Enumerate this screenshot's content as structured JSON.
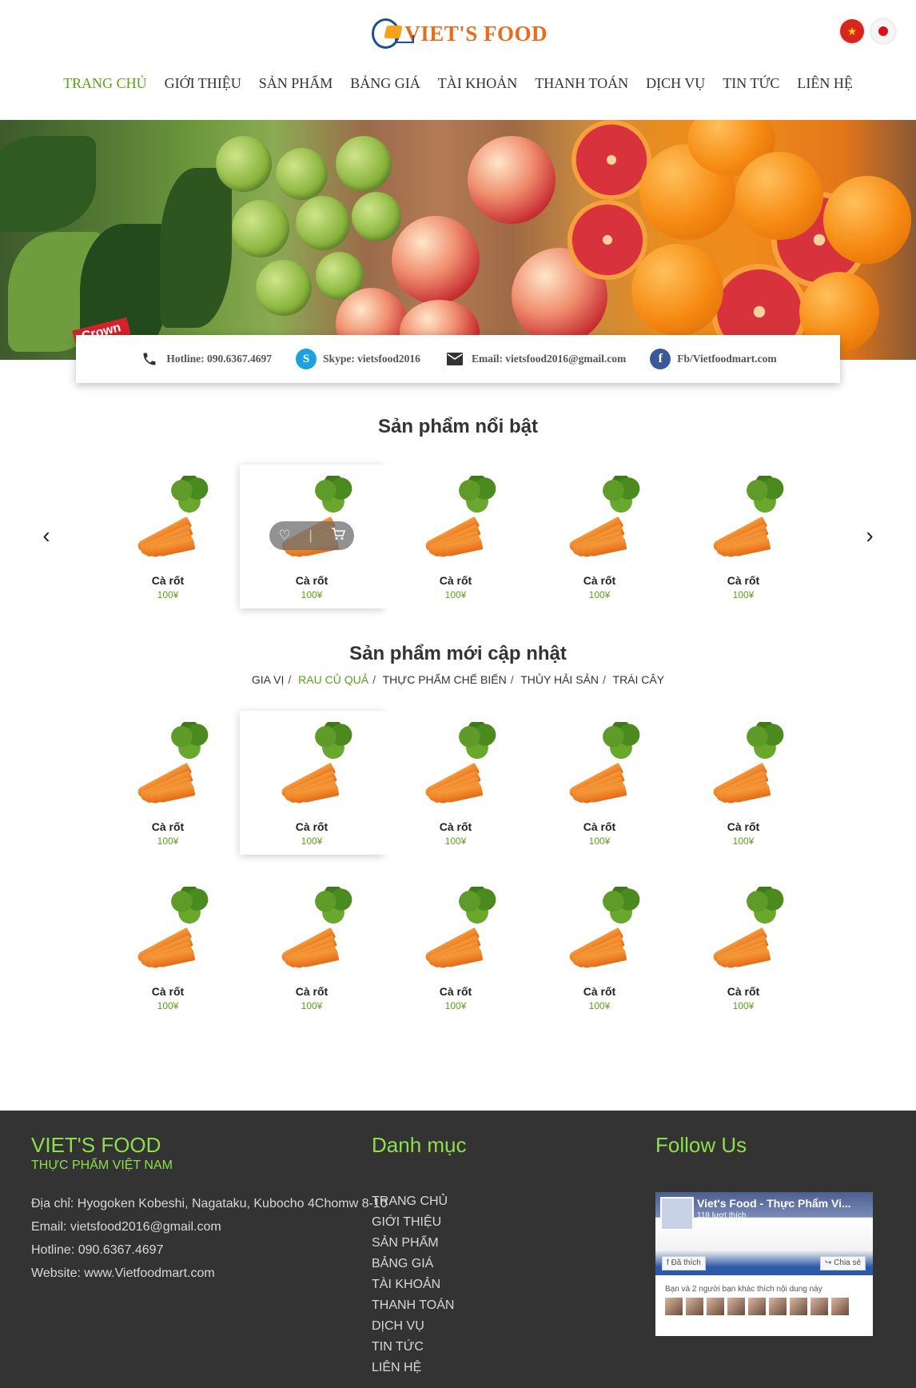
{
  "brand": {
    "logo_text": "VIET'S FOOD"
  },
  "nav": [
    "TRANG CHỦ",
    "GIỚI THIỆU",
    "SẢN PHẨM",
    "BẢNG GIÁ",
    "TÀI KHOẢN",
    "THANH TOÁN",
    "DỊCH VỤ",
    "TIN TỨC",
    "LIÊN HỆ"
  ],
  "nav_active_index": 0,
  "hero": {
    "ribbon_text": "Crown"
  },
  "contact": {
    "hotline": "Hotline: 090.6367.4697",
    "skype": "Skype: vietsfood2016",
    "email": "Email: vietsfood2016@gmail.com",
    "facebook": "Fb/Vietfoodmart.com"
  },
  "featured": {
    "title": "Sản phẩm nổi bật",
    "products": [
      {
        "name": "Cà rốt",
        "price": "100¥"
      },
      {
        "name": "Cà rốt",
        "price": "100¥"
      },
      {
        "name": "Cà rốt",
        "price": "100¥"
      },
      {
        "name": "Cà rốt",
        "price": "100¥"
      },
      {
        "name": "Cà rốt",
        "price": "100¥"
      }
    ]
  },
  "latest": {
    "title": "Sản phẩm mới cập nhật",
    "filters": [
      "GIA VỊ",
      "RAU CỦ QUẢ",
      "THỰC PHẨM CHẾ BIẾN",
      "THỦY HẢI SẢN",
      "TRÁI CÂY"
    ],
    "active_filter": 1,
    "row1": [
      {
        "name": "Cà rốt",
        "price": "100¥"
      },
      {
        "name": "Cà rốt",
        "price": "100¥"
      },
      {
        "name": "Cà rốt",
        "price": "100¥"
      },
      {
        "name": "Cà rốt",
        "price": "100¥"
      },
      {
        "name": "Cà rốt",
        "price": "100¥"
      }
    ],
    "row2": [
      {
        "name": "Cà rốt",
        "price": "100¥"
      },
      {
        "name": "Cà rốt",
        "price": "100¥"
      },
      {
        "name": "Cà rốt",
        "price": "100¥"
      },
      {
        "name": "Cà rốt",
        "price": "100¥"
      },
      {
        "name": "Cà rốt",
        "price": "100¥"
      }
    ]
  },
  "footer": {
    "brand": "VIET'S FOOD",
    "tagline": "THỰC PHẨM VIỆT NAM",
    "address": "Địa chỉ: Hyogoken Kobeshi, Nagataku, Kubocho 4Chomw 8-10",
    "email": "Email: vietsfood2016@gmail.com",
    "hotline": "Hotline: 090.6367.4697",
    "website": "Website: www.Vietfoodmart.com",
    "categories_title": "Danh mục",
    "categories": [
      "TRANG CHỦ",
      "GIỚI THIỆU",
      "SẢN PHẨM",
      "BẢNG GIÁ",
      "TÀI KHOẢN",
      "THANH TOÁN",
      "DỊCH VỤ",
      "TIN TỨC",
      "LIÊN HỆ"
    ],
    "follow_title": "Follow Us",
    "fb_page_title": "Viet's Food - Thực Phẩm Vi...",
    "fb_likes": "118 lượt thích",
    "fb_like_button": "Đã thích",
    "fb_share_button": "Chia sẻ",
    "fb_friends_text": "Bạn và 2 người bạn khác thích nội dung này"
  },
  "colors": {
    "accent_green": "#5aa21a",
    "footer_bg": "#333333",
    "footer_heading": "#8de04b",
    "logo_orange": "#ec6a1b"
  }
}
